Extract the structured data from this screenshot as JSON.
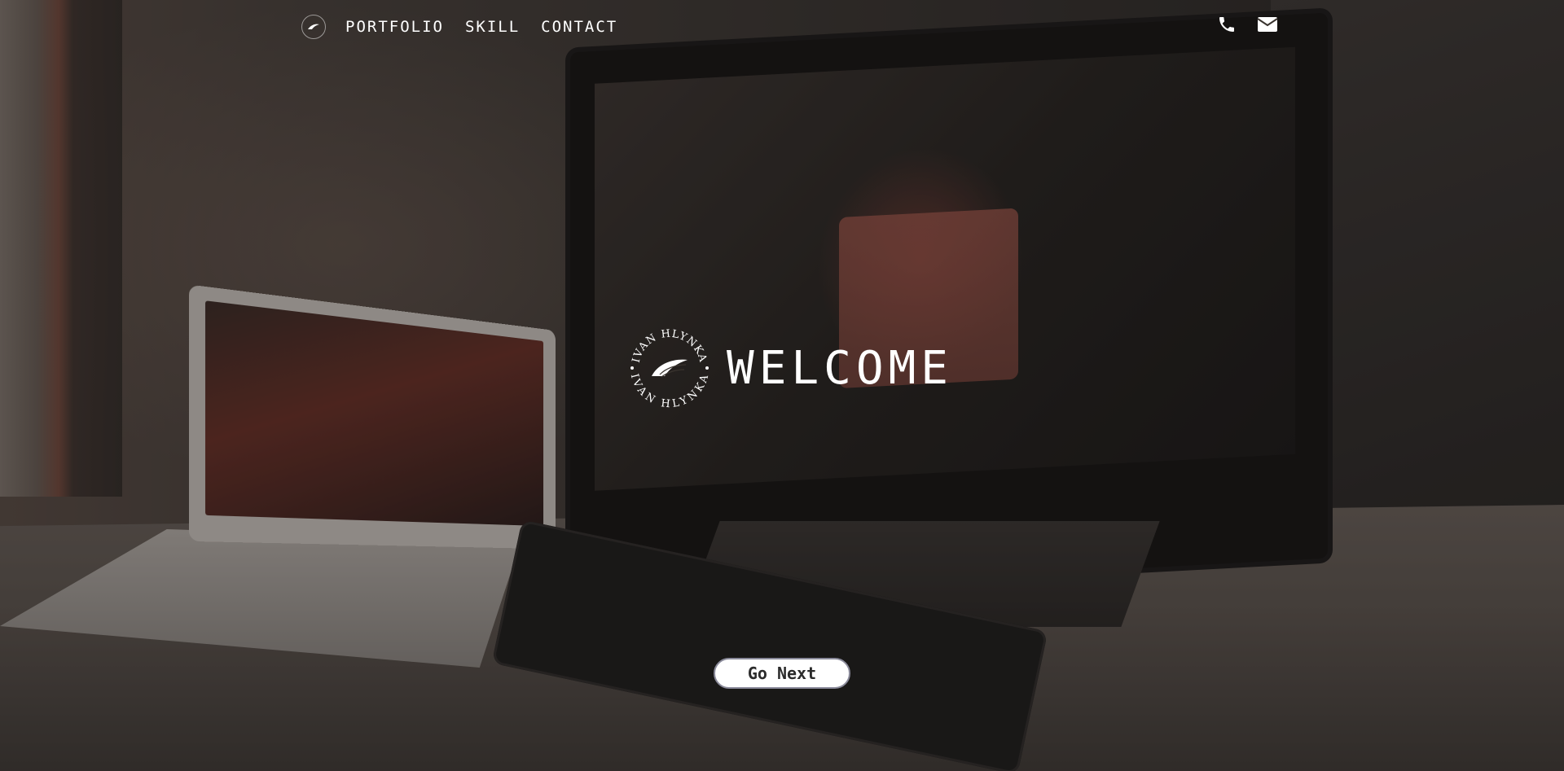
{
  "nav": {
    "links": [
      {
        "label": "PORTFOLIO"
      },
      {
        "label": "SKILL"
      },
      {
        "label": "CONTACT"
      }
    ],
    "icons": [
      "phone-icon",
      "envelope-icon"
    ]
  },
  "hero": {
    "emblem_text_top": "IVAN HLYNKA",
    "emblem_text_bottom": "IVAN HLYNKA",
    "title": "WELCOME",
    "button_label": "Go Next"
  },
  "colors": {
    "text": "#ffffff",
    "button_bg": "#ffffff",
    "button_text": "#2b2b2b"
  }
}
